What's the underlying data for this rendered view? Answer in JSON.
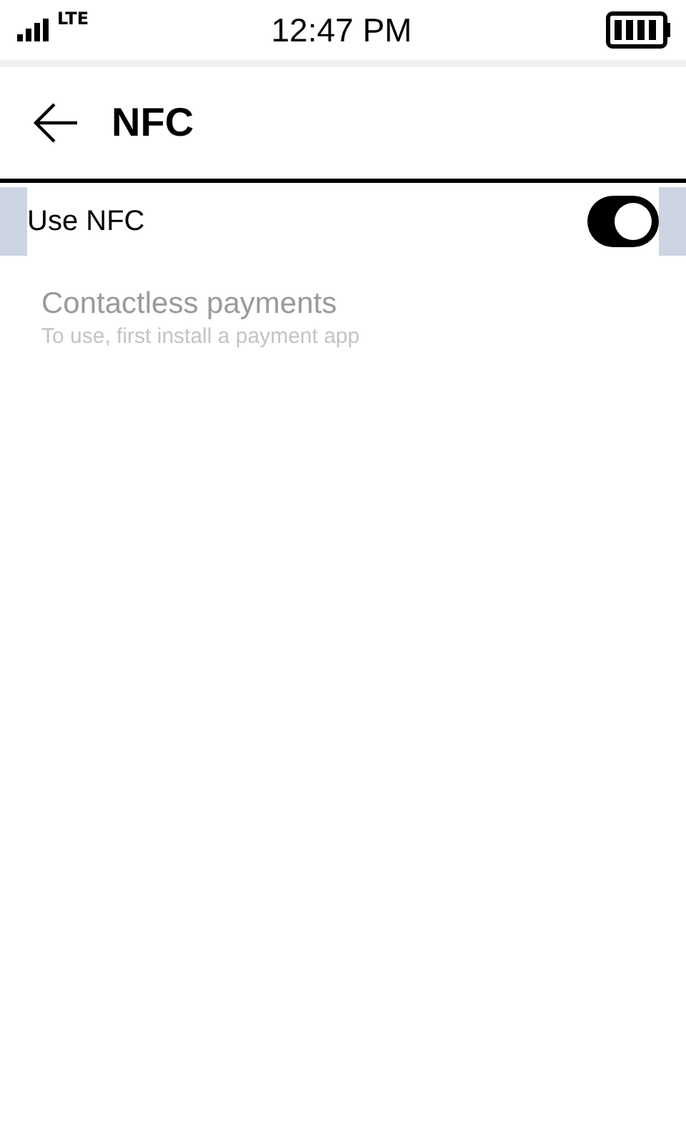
{
  "status_bar": {
    "network": "LTE",
    "time": "12:47 PM"
  },
  "header": {
    "title": "NFC"
  },
  "settings": [
    {
      "kind": "toggle",
      "label": "Use NFC",
      "on": true,
      "selected": true,
      "disabled": false
    },
    {
      "kind": "info",
      "label": "Contactless payments",
      "summary": "To use, first install a payment app",
      "selected": false,
      "disabled": true
    }
  ]
}
